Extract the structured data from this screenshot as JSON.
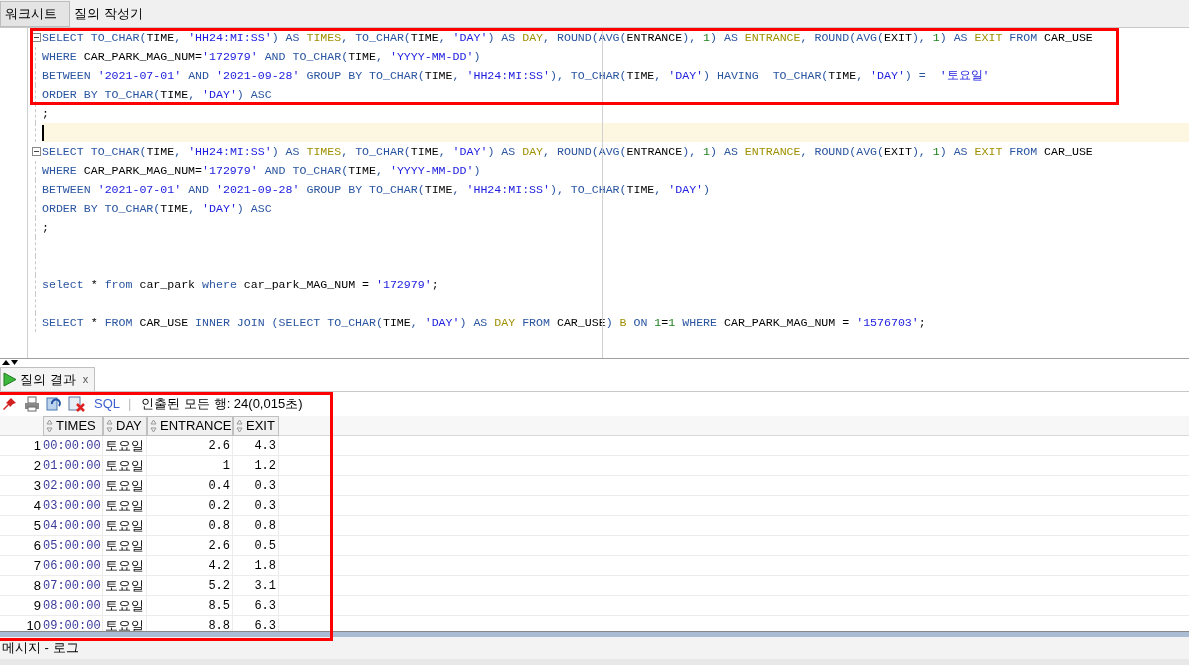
{
  "tabs": [
    {
      "label": "워크시트",
      "selected": true
    },
    {
      "label": "질의 작성기",
      "selected": false
    }
  ],
  "editor": {
    "lines": [
      {
        "kind": "code",
        "fold": true,
        "tokens": [
          {
            "kind": "keyword",
            "text": "SELECT TO_CHAR("
          },
          {
            "kind": "name",
            "text": "TIME"
          },
          {
            "kind": "keyword",
            "text": ", "
          },
          {
            "kind": "string",
            "text": "'HH24:MI:SS'"
          },
          {
            "kind": "keyword",
            "text": ") AS "
          },
          {
            "kind": "alias",
            "text": "TIMES"
          },
          {
            "kind": "keyword",
            "text": ", TO_CHAR("
          },
          {
            "kind": "name",
            "text": "TIME"
          },
          {
            "kind": "keyword",
            "text": ", "
          },
          {
            "kind": "string",
            "text": "'DAY'"
          },
          {
            "kind": "keyword",
            "text": ") AS "
          },
          {
            "kind": "alias",
            "text": "DAY"
          },
          {
            "kind": "keyword",
            "text": ", ROUND(AVG("
          },
          {
            "kind": "name",
            "text": "ENTRANCE"
          },
          {
            "kind": "keyword",
            "text": "), "
          },
          {
            "kind": "number",
            "text": "1"
          },
          {
            "kind": "keyword",
            "text": ") AS "
          },
          {
            "kind": "alias",
            "text": "ENTRANCE"
          },
          {
            "kind": "keyword",
            "text": ", ROUND(AVG("
          },
          {
            "kind": "name",
            "text": "EXIT"
          },
          {
            "kind": "keyword",
            "text": "), "
          },
          {
            "kind": "number",
            "text": "1"
          },
          {
            "kind": "keyword",
            "text": ") AS "
          },
          {
            "kind": "alias",
            "text": "EXIT"
          },
          {
            "kind": "keyword",
            "text": " FROM "
          },
          {
            "kind": "name",
            "text": "CAR_USE"
          }
        ]
      },
      {
        "kind": "code",
        "fold": false,
        "tokens": [
          {
            "kind": "keyword",
            "text": "WHERE "
          },
          {
            "kind": "name",
            "text": "CAR_PARK_MAG_NUM="
          },
          {
            "kind": "string",
            "text": "'172979'"
          },
          {
            "kind": "keyword",
            "text": " AND TO_CHAR("
          },
          {
            "kind": "name",
            "text": "TIME"
          },
          {
            "kind": "keyword",
            "text": ", "
          },
          {
            "kind": "string",
            "text": "'YYYY-MM-DD'"
          },
          {
            "kind": "keyword",
            "text": ")"
          }
        ]
      },
      {
        "kind": "code",
        "fold": false,
        "tokens": [
          {
            "kind": "keyword",
            "text": "BETWEEN "
          },
          {
            "kind": "string",
            "text": "'2021-07-01'"
          },
          {
            "kind": "keyword",
            "text": " AND "
          },
          {
            "kind": "string",
            "text": "'2021-09-28'"
          },
          {
            "kind": "keyword",
            "text": " GROUP BY TO_CHAR("
          },
          {
            "kind": "name",
            "text": "TIME"
          },
          {
            "kind": "keyword",
            "text": ", "
          },
          {
            "kind": "string",
            "text": "'HH24:MI:SS'"
          },
          {
            "kind": "keyword",
            "text": "), TO_CHAR("
          },
          {
            "kind": "name",
            "text": "TIME"
          },
          {
            "kind": "keyword",
            "text": ", "
          },
          {
            "kind": "string",
            "text": "'DAY'"
          },
          {
            "kind": "keyword",
            "text": ") HAVING  TO_CHAR("
          },
          {
            "kind": "name",
            "text": "TIME"
          },
          {
            "kind": "keyword",
            "text": ", "
          },
          {
            "kind": "string",
            "text": "'DAY'"
          },
          {
            "kind": "keyword",
            "text": ") =  "
          },
          {
            "kind": "string",
            "text": "'토요일'"
          }
        ]
      },
      {
        "kind": "code",
        "fold": false,
        "tokens": [
          {
            "kind": "keyword",
            "text": "ORDER BY TO_CHAR("
          },
          {
            "kind": "name",
            "text": "TIME"
          },
          {
            "kind": "keyword",
            "text": ", "
          },
          {
            "kind": "string",
            "text": "'DAY'"
          },
          {
            "kind": "keyword",
            "text": ") ASC"
          }
        ]
      },
      {
        "kind": "code",
        "fold": false,
        "tokens": [
          {
            "kind": "name",
            "text": ";"
          }
        ]
      },
      {
        "kind": "cursor",
        "fold": false
      },
      {
        "kind": "code",
        "fold": true,
        "tokens": [
          {
            "kind": "keyword",
            "text": "SELECT TO_CHAR("
          },
          {
            "kind": "name",
            "text": "TIME"
          },
          {
            "kind": "keyword",
            "text": ", "
          },
          {
            "kind": "string",
            "text": "'HH24:MI:SS'"
          },
          {
            "kind": "keyword",
            "text": ") AS "
          },
          {
            "kind": "alias",
            "text": "TIMES"
          },
          {
            "kind": "keyword",
            "text": ", TO_CHAR("
          },
          {
            "kind": "name",
            "text": "TIME"
          },
          {
            "kind": "keyword",
            "text": ", "
          },
          {
            "kind": "string",
            "text": "'DAY'"
          },
          {
            "kind": "keyword",
            "text": ") AS "
          },
          {
            "kind": "alias",
            "text": "DAY"
          },
          {
            "kind": "keyword",
            "text": ", ROUND(AVG("
          },
          {
            "kind": "name",
            "text": "ENTRANCE"
          },
          {
            "kind": "keyword",
            "text": "), "
          },
          {
            "kind": "number",
            "text": "1"
          },
          {
            "kind": "keyword",
            "text": ") AS "
          },
          {
            "kind": "alias",
            "text": "ENTRANCE"
          },
          {
            "kind": "keyword",
            "text": ", ROUND(AVG("
          },
          {
            "kind": "name",
            "text": "EXIT"
          },
          {
            "kind": "keyword",
            "text": "), "
          },
          {
            "kind": "number",
            "text": "1"
          },
          {
            "kind": "keyword",
            "text": ") AS "
          },
          {
            "kind": "alias",
            "text": "EXIT"
          },
          {
            "kind": "keyword",
            "text": " FROM "
          },
          {
            "kind": "name",
            "text": "CAR_USE"
          }
        ]
      },
      {
        "kind": "code",
        "fold": false,
        "tokens": [
          {
            "kind": "keyword",
            "text": "WHERE "
          },
          {
            "kind": "name",
            "text": "CAR_PARK_MAG_NUM="
          },
          {
            "kind": "string",
            "text": "'172979'"
          },
          {
            "kind": "keyword",
            "text": " AND TO_CHAR("
          },
          {
            "kind": "name",
            "text": "TIME"
          },
          {
            "kind": "keyword",
            "text": ", "
          },
          {
            "kind": "string",
            "text": "'YYYY-MM-DD'"
          },
          {
            "kind": "keyword",
            "text": ")"
          }
        ]
      },
      {
        "kind": "code",
        "fold": false,
        "tokens": [
          {
            "kind": "keyword",
            "text": "BETWEEN "
          },
          {
            "kind": "string",
            "text": "'2021-07-01'"
          },
          {
            "kind": "keyword",
            "text": " AND "
          },
          {
            "kind": "string",
            "text": "'2021-09-28'"
          },
          {
            "kind": "keyword",
            "text": " GROUP BY TO_CHAR("
          },
          {
            "kind": "name",
            "text": "TIME"
          },
          {
            "kind": "keyword",
            "text": ", "
          },
          {
            "kind": "string",
            "text": "'HH24:MI:SS'"
          },
          {
            "kind": "keyword",
            "text": "), TO_CHAR("
          },
          {
            "kind": "name",
            "text": "TIME"
          },
          {
            "kind": "keyword",
            "text": ", "
          },
          {
            "kind": "string",
            "text": "'DAY'"
          },
          {
            "kind": "keyword",
            "text": ")"
          }
        ]
      },
      {
        "kind": "code",
        "fold": false,
        "tokens": [
          {
            "kind": "keyword",
            "text": "ORDER BY TO_CHAR("
          },
          {
            "kind": "name",
            "text": "TIME"
          },
          {
            "kind": "keyword",
            "text": ", "
          },
          {
            "kind": "string",
            "text": "'DAY'"
          },
          {
            "kind": "keyword",
            "text": ") ASC"
          }
        ]
      },
      {
        "kind": "code",
        "fold": false,
        "tokens": [
          {
            "kind": "name",
            "text": ";"
          }
        ]
      },
      {
        "kind": "blank",
        "fold": false
      },
      {
        "kind": "blank",
        "fold": false
      },
      {
        "kind": "code",
        "fold": false,
        "tokens": [
          {
            "kind": "keyword",
            "text": "select "
          },
          {
            "kind": "name",
            "text": "*"
          },
          {
            "kind": "keyword",
            "text": " from "
          },
          {
            "kind": "name",
            "text": "car_park"
          },
          {
            "kind": "keyword",
            "text": " where "
          },
          {
            "kind": "name",
            "text": "car_park_MAG_NUM = "
          },
          {
            "kind": "string",
            "text": "'172979'"
          },
          {
            "kind": "name",
            "text": ";"
          }
        ]
      },
      {
        "kind": "blank",
        "fold": false
      },
      {
        "kind": "code",
        "fold": false,
        "tokens": [
          {
            "kind": "keyword",
            "text": "SELECT "
          },
          {
            "kind": "name",
            "text": "*"
          },
          {
            "kind": "keyword",
            "text": " FROM "
          },
          {
            "kind": "name",
            "text": "CAR_USE"
          },
          {
            "kind": "keyword",
            "text": " INNER JOIN (SELECT TO_CHAR("
          },
          {
            "kind": "name",
            "text": "TIME"
          },
          {
            "kind": "keyword",
            "text": ", "
          },
          {
            "kind": "string",
            "text": "'DAY'"
          },
          {
            "kind": "keyword",
            "text": ") AS "
          },
          {
            "kind": "alias",
            "text": "DAY"
          },
          {
            "kind": "keyword",
            "text": " FROM "
          },
          {
            "kind": "name",
            "text": "CAR_USE"
          },
          {
            "kind": "keyword",
            "text": ") "
          },
          {
            "kind": "alias",
            "text": "B"
          },
          {
            "kind": "keyword",
            "text": " ON "
          },
          {
            "kind": "number",
            "text": "1"
          },
          {
            "kind": "name",
            "text": "="
          },
          {
            "kind": "number",
            "text": "1"
          },
          {
            "kind": "keyword",
            "text": " WHERE "
          },
          {
            "kind": "name",
            "text": "CAR_PARK_MAG_NUM = "
          },
          {
            "kind": "string",
            "text": "'1576703'"
          },
          {
            "kind": "name",
            "text": ";"
          }
        ]
      }
    ]
  },
  "results": {
    "tab": {
      "label": "질의 결과",
      "close": "x"
    },
    "toolbar": {
      "sql": "SQL",
      "separator": "|",
      "status": "인출된 모든 행: 24(0,015초)"
    },
    "columns": [
      "",
      "TIMES",
      "DAY",
      "ENTRANCE",
      "EXIT"
    ],
    "rows": [
      [
        "1",
        "00:00:00",
        "토요일",
        "2.6",
        "4.3"
      ],
      [
        "2",
        "01:00:00",
        "토요일",
        "1",
        "1.2"
      ],
      [
        "3",
        "02:00:00",
        "토요일",
        "0.4",
        "0.3"
      ],
      [
        "4",
        "03:00:00",
        "토요일",
        "0.2",
        "0.3"
      ],
      [
        "5",
        "04:00:00",
        "토요일",
        "0.8",
        "0.8"
      ],
      [
        "6",
        "05:00:00",
        "토요일",
        "2.6",
        "0.5"
      ],
      [
        "7",
        "06:00:00",
        "토요일",
        "4.2",
        "1.8"
      ],
      [
        "8",
        "07:00:00",
        "토요일",
        "5.2",
        "3.1"
      ],
      [
        "9",
        "08:00:00",
        "토요일",
        "8.5",
        "6.3"
      ],
      [
        "10",
        "09:00:00",
        "토요일",
        "8.8",
        "6.3"
      ]
    ]
  },
  "log_panel": {
    "title": "메시지 - 로그"
  }
}
